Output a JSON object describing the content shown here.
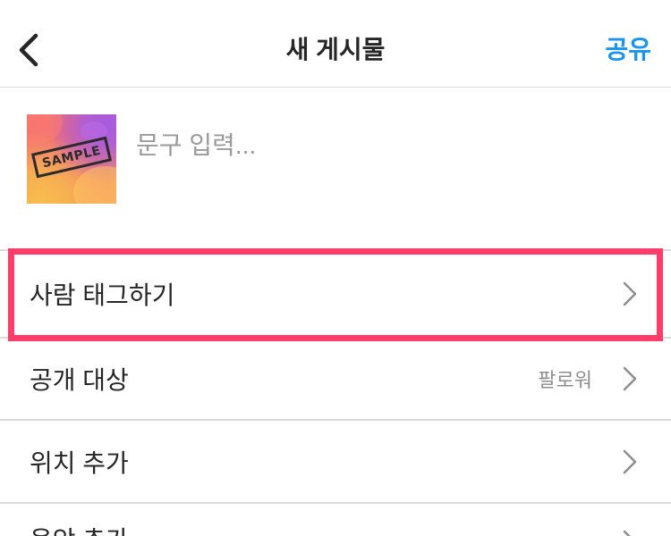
{
  "header": {
    "title": "새 게시물",
    "share_label": "공유",
    "back_icon": "chevron-left-icon"
  },
  "composer": {
    "caption_placeholder": "문구 입력...",
    "thumbnail": {
      "stamp_text": "SAMPLE"
    }
  },
  "options": [
    {
      "label": "사람 태그하기",
      "icon": "chevron-right-icon",
      "highlighted": true
    },
    {
      "label": "공개 대상",
      "value": "팔로워",
      "icon": "chevron-right-icon"
    },
    {
      "label": "위치 추가",
      "icon": "chevron-right-icon"
    },
    {
      "label": "음악 추가",
      "icon": "chevron-right-icon"
    }
  ],
  "colors": {
    "accent": "#1a95ef",
    "highlight_border": "#ff3d6b",
    "text_primary": "#262626",
    "text_secondary": "#8e8e8e",
    "divider": "#dbdbdb"
  }
}
